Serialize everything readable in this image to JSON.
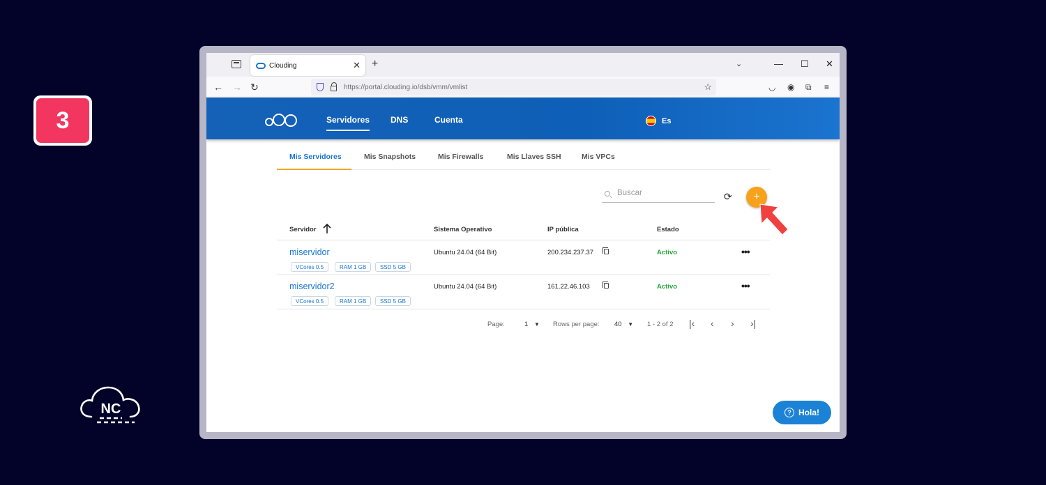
{
  "step": {
    "number": "3"
  },
  "brand": {
    "logo_text": "NC"
  },
  "browser": {
    "tab_title": "Clouding",
    "tab_close": "✕",
    "new_tab": "+",
    "url": "https://portal.clouding.io/dsb/vmm/vmlist",
    "window_controls": [
      "—",
      "☐",
      "✕"
    ]
  },
  "site": {
    "nav": [
      "Servidores",
      "DNS",
      "Cuenta"
    ],
    "active_nav": "Servidores",
    "language": "Es"
  },
  "subtabs": [
    "Mis Servidores",
    "Mis Snapshots",
    "Mis Firewalls",
    "Mis Llaves SSH",
    "Mis VPCs"
  ],
  "search": {
    "placeholder": "Buscar",
    "value": ""
  },
  "add_button": {
    "label": "+"
  },
  "table": {
    "columns": [
      "Servidor",
      "Sistema Operativo",
      "IP pública",
      "Estado"
    ],
    "rows": [
      {
        "name": "miservidor",
        "specs": [
          "VCores  0.5",
          "RAM  1 GB",
          "SSD  5 GB"
        ],
        "os": "Ubuntu 24.04 (64 Bit)",
        "ip": "200.234.237.37",
        "status": "Activo"
      },
      {
        "name": "miservidor2",
        "specs": [
          "VCores  0.5",
          "RAM  1 GB",
          "SSD  5 GB"
        ],
        "os": "Ubuntu 24.04 (64 Bit)",
        "ip": "161.22.46.103",
        "status": "Activo"
      }
    ]
  },
  "pagination": {
    "page_label": "Page:",
    "page_value": "1",
    "rows_label": "Rows per page:",
    "rows_value": "40",
    "range": "1 - 2 of 2"
  },
  "chat": {
    "label": "Hola!"
  },
  "colors": {
    "accent": "#1976d2",
    "add_button": "#f7a21a",
    "status_active": "#22a83a",
    "badge": "#f2365f",
    "pointer_arrow": "#f04040"
  }
}
